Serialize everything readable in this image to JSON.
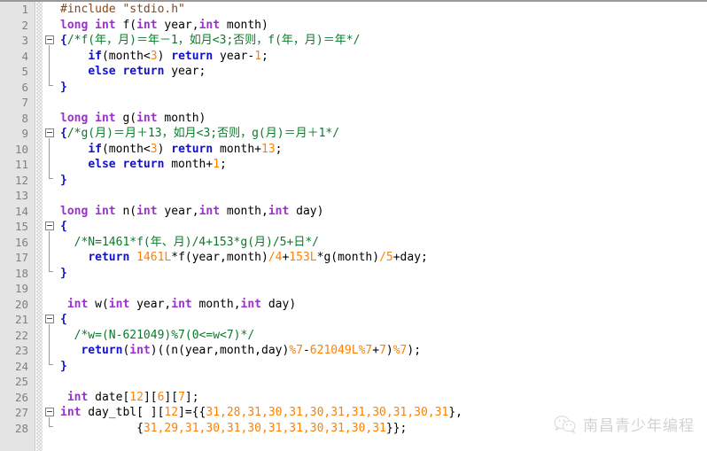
{
  "editor": {
    "name": "c-source-code-editor",
    "language": "C",
    "colors": {
      "background": "#ffffff",
      "gutter_background": "#e4e4e4",
      "line_number": "#808080",
      "preprocessor": "#8b4513",
      "type_keyword": "#9b30d0",
      "control_keyword": "#1111cc",
      "number": "#ff8000",
      "comment": "#0a7a2a",
      "identifier": "#000000"
    },
    "lines": [
      {
        "number": "1",
        "fold": "none",
        "tokens": [
          {
            "t": "#include \"stdio.h\"",
            "c": "t-pre"
          }
        ]
      },
      {
        "number": "2",
        "fold": "none",
        "tokens": [
          {
            "t": "long int",
            "c": "t-type"
          },
          {
            "t": " f(",
            "c": "t-id"
          },
          {
            "t": "int",
            "c": "t-type"
          },
          {
            "t": " year,",
            "c": "t-id"
          },
          {
            "t": "int",
            "c": "t-type"
          },
          {
            "t": " month)",
            "c": "t-id"
          }
        ]
      },
      {
        "number": "3",
        "fold": "start",
        "tokens": [
          {
            "t": "{",
            "c": "t-kw"
          },
          {
            "t": "/*f(年，月)＝年－1，如月<3;否则，f(年，月)＝年*/",
            "c": "t-cmt"
          }
        ]
      },
      {
        "number": "4",
        "fold": "mid",
        "tokens": [
          {
            "t": "    ",
            "c": "t-id"
          },
          {
            "t": "if",
            "c": "t-kw"
          },
          {
            "t": "(month<",
            "c": "t-id"
          },
          {
            "t": "3",
            "c": "t-num"
          },
          {
            "t": ") ",
            "c": "t-id"
          },
          {
            "t": "return",
            "c": "t-kw"
          },
          {
            "t": " year-",
            "c": "t-id"
          },
          {
            "t": "1",
            "c": "t-num"
          },
          {
            "t": ";",
            "c": "t-id"
          }
        ]
      },
      {
        "number": "5",
        "fold": "mid",
        "tokens": [
          {
            "t": "    ",
            "c": "t-id"
          },
          {
            "t": "else return",
            "c": "t-kw"
          },
          {
            "t": " year;",
            "c": "t-id"
          }
        ]
      },
      {
        "number": "6",
        "fold": "end",
        "tokens": [
          {
            "t": "}",
            "c": "t-kw"
          }
        ]
      },
      {
        "number": "7",
        "fold": "none",
        "tokens": []
      },
      {
        "number": "8",
        "fold": "none",
        "tokens": [
          {
            "t": "long int",
            "c": "t-type"
          },
          {
            "t": " g(",
            "c": "t-id"
          },
          {
            "t": "int",
            "c": "t-type"
          },
          {
            "t": " month)",
            "c": "t-id"
          }
        ]
      },
      {
        "number": "9",
        "fold": "start",
        "tokens": [
          {
            "t": "{",
            "c": "t-kw"
          },
          {
            "t": "/*g(月)＝月＋13，如月<3;否则，g(月)＝月＋1*/",
            "c": "t-cmt"
          }
        ]
      },
      {
        "number": "10",
        "fold": "mid",
        "tokens": [
          {
            "t": "    ",
            "c": "t-id"
          },
          {
            "t": "if",
            "c": "t-kw"
          },
          {
            "t": "(month<",
            "c": "t-id"
          },
          {
            "t": "3",
            "c": "t-num"
          },
          {
            "t": ") ",
            "c": "t-id"
          },
          {
            "t": "return",
            "c": "t-kw"
          },
          {
            "t": " month+",
            "c": "t-id"
          },
          {
            "t": "13",
            "c": "t-num"
          },
          {
            "t": ";",
            "c": "t-id"
          }
        ]
      },
      {
        "number": "11",
        "fold": "mid",
        "tokens": [
          {
            "t": "    ",
            "c": "t-id"
          },
          {
            "t": "else return",
            "c": "t-kw"
          },
          {
            "t": " month+",
            "c": "t-id"
          },
          {
            "t": "1",
            "c": "t-num"
          },
          {
            "t": ";",
            "c": "t-id"
          }
        ]
      },
      {
        "number": "12",
        "fold": "end",
        "tokens": [
          {
            "t": "}",
            "c": "t-kw"
          }
        ]
      },
      {
        "number": "13",
        "fold": "none",
        "tokens": []
      },
      {
        "number": "14",
        "fold": "none",
        "tokens": [
          {
            "t": "long int",
            "c": "t-type"
          },
          {
            "t": " n(",
            "c": "t-id"
          },
          {
            "t": "int",
            "c": "t-type"
          },
          {
            "t": " year,",
            "c": "t-id"
          },
          {
            "t": "int",
            "c": "t-type"
          },
          {
            "t": " month,",
            "c": "t-id"
          },
          {
            "t": "int",
            "c": "t-type"
          },
          {
            "t": " day)",
            "c": "t-id"
          }
        ]
      },
      {
        "number": "15",
        "fold": "start",
        "tokens": [
          {
            "t": "{",
            "c": "t-kw"
          }
        ]
      },
      {
        "number": "16",
        "fold": "mid",
        "tokens": [
          {
            "t": "  ",
            "c": "t-id"
          },
          {
            "t": "/*N=1461*f(年、月)/4+153*g(月)/5+日*/",
            "c": "t-cmt"
          }
        ]
      },
      {
        "number": "17",
        "fold": "mid",
        "tokens": [
          {
            "t": "    ",
            "c": "t-id"
          },
          {
            "t": "return",
            "c": "t-kw"
          },
          {
            "t": " ",
            "c": "t-id"
          },
          {
            "t": "1461L",
            "c": "t-num"
          },
          {
            "t": "*f(year,month)",
            "c": "t-id"
          },
          {
            "t": "/4",
            "c": "t-num"
          },
          {
            "t": "+",
            "c": "t-id"
          },
          {
            "t": "153L",
            "c": "t-num"
          },
          {
            "t": "*g(month)",
            "c": "t-id"
          },
          {
            "t": "/5",
            "c": "t-num"
          },
          {
            "t": "+day;",
            "c": "t-id"
          }
        ]
      },
      {
        "number": "18",
        "fold": "end",
        "tokens": [
          {
            "t": "}",
            "c": "t-kw"
          }
        ]
      },
      {
        "number": "19",
        "fold": "none",
        "tokens": []
      },
      {
        "number": "20",
        "fold": "none",
        "tokens": [
          {
            "t": " ",
            "c": "t-id"
          },
          {
            "t": "int",
            "c": "t-type"
          },
          {
            "t": " w(",
            "c": "t-id"
          },
          {
            "t": "int",
            "c": "t-type"
          },
          {
            "t": " year,",
            "c": "t-id"
          },
          {
            "t": "int",
            "c": "t-type"
          },
          {
            "t": " month,",
            "c": "t-id"
          },
          {
            "t": "int",
            "c": "t-type"
          },
          {
            "t": " day)",
            "c": "t-id"
          }
        ]
      },
      {
        "number": "21",
        "fold": "start",
        "tokens": [
          {
            "t": "{",
            "c": "t-kw"
          }
        ]
      },
      {
        "number": "22",
        "fold": "mid",
        "tokens": [
          {
            "t": "  ",
            "c": "t-id"
          },
          {
            "t": "/*w=(N-621049)%7(0<=w<7)*/",
            "c": "t-cmt"
          }
        ]
      },
      {
        "number": "23",
        "fold": "mid",
        "tokens": [
          {
            "t": "   ",
            "c": "t-id"
          },
          {
            "t": "return",
            "c": "t-kw"
          },
          {
            "t": "(",
            "c": "t-id"
          },
          {
            "t": "int",
            "c": "t-type"
          },
          {
            "t": ")((n(year,month,day)",
            "c": "t-id"
          },
          {
            "t": "%7",
            "c": "t-num"
          },
          {
            "t": "-",
            "c": "t-id"
          },
          {
            "t": "621049L",
            "c": "t-num"
          },
          {
            "t": "%7",
            "c": "t-num"
          },
          {
            "t": "+",
            "c": "t-id"
          },
          {
            "t": "7",
            "c": "t-num"
          },
          {
            "t": ")",
            "c": "t-id"
          },
          {
            "t": "%7",
            "c": "t-num"
          },
          {
            "t": ");",
            "c": "t-id"
          }
        ]
      },
      {
        "number": "24",
        "fold": "end",
        "tokens": [
          {
            "t": "}",
            "c": "t-kw"
          }
        ]
      },
      {
        "number": "25",
        "fold": "none",
        "tokens": []
      },
      {
        "number": "26",
        "fold": "none",
        "tokens": [
          {
            "t": " ",
            "c": "t-id"
          },
          {
            "t": "int",
            "c": "t-type"
          },
          {
            "t": " date[",
            "c": "t-id"
          },
          {
            "t": "12",
            "c": "t-num"
          },
          {
            "t": "][",
            "c": "t-id"
          },
          {
            "t": "6",
            "c": "t-num"
          },
          {
            "t": "][",
            "c": "t-id"
          },
          {
            "t": "7",
            "c": "t-num"
          },
          {
            "t": "];",
            "c": "t-id"
          }
        ]
      },
      {
        "number": "27",
        "fold": "start",
        "tokens": [
          {
            "t": "int",
            "c": "t-type"
          },
          {
            "t": " day_tbl[ ][",
            "c": "t-id"
          },
          {
            "t": "12",
            "c": "t-num"
          },
          {
            "t": "]={{",
            "c": "t-id"
          },
          {
            "t": "31,28,31,30,31,30,31,31,30,31,30,31",
            "c": "t-num"
          },
          {
            "t": "},",
            "c": "t-id"
          }
        ]
      },
      {
        "number": "28",
        "fold": "end",
        "tokens": [
          {
            "t": "           {",
            "c": "t-id"
          },
          {
            "t": "31,29,31,30,31,30,31,31,30,31,30,31",
            "c": "t-num"
          },
          {
            "t": "}};",
            "c": "t-id"
          }
        ]
      }
    ]
  },
  "watermark": {
    "icon": "wechat-icon",
    "text": "南昌青少年编程"
  }
}
